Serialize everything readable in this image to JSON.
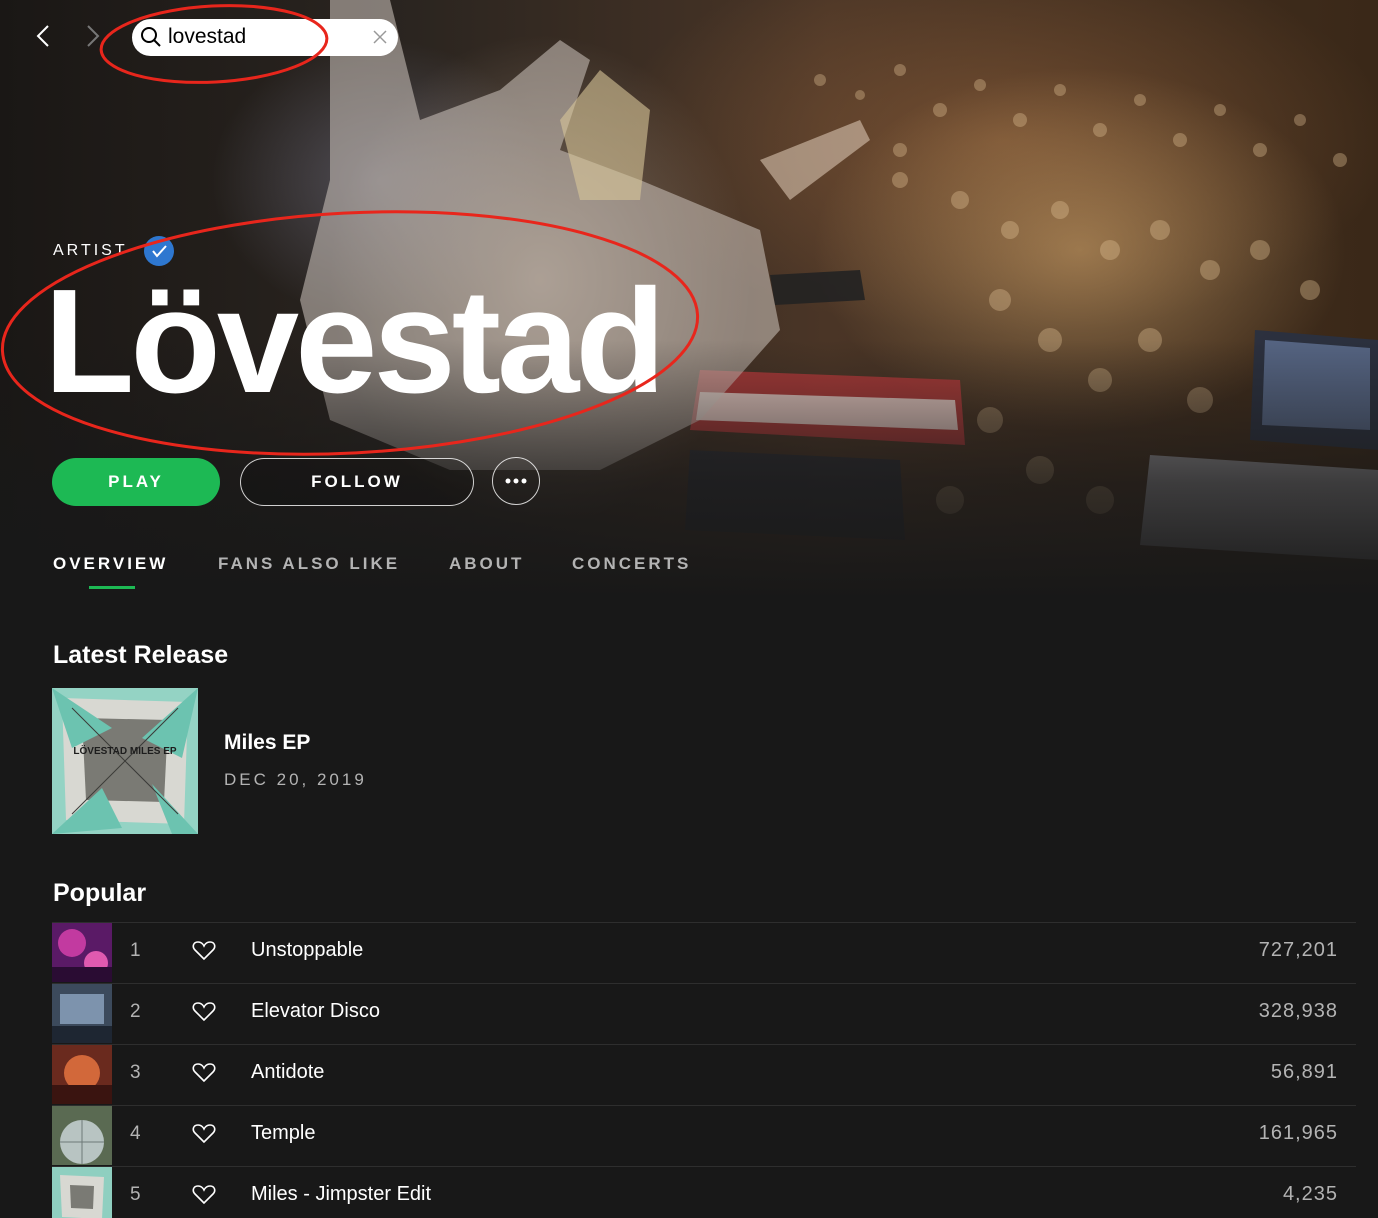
{
  "search": {
    "query": "lovestad"
  },
  "header": {
    "label": "ARTIST",
    "artist_name": "Lövestad"
  },
  "actions": {
    "play_label": "PLAY",
    "follow_label": "FOLLOW"
  },
  "tabs": [
    {
      "label": "OVERVIEW",
      "active": true
    },
    {
      "label": "FANS ALSO LIKE",
      "active": false
    },
    {
      "label": "ABOUT",
      "active": false
    },
    {
      "label": "CONCERTS",
      "active": false
    }
  ],
  "latest_release": {
    "section_title": "Latest Release",
    "cover_text": "LÖVESTAD MILES EP",
    "title": "Miles EP",
    "date": "DEC 20, 2019"
  },
  "popular": {
    "section_title": "Popular",
    "tracks": [
      {
        "num": "1",
        "title": "Unstoppable",
        "plays": "727,201"
      },
      {
        "num": "2",
        "title": "Elevator Disco",
        "plays": "328,938"
      },
      {
        "num": "3",
        "title": "Antidote",
        "plays": "56,891"
      },
      {
        "num": "4",
        "title": "Temple",
        "plays": "161,965"
      },
      {
        "num": "5",
        "title": "Miles - Jimpster Edit",
        "plays": "4,235"
      }
    ]
  },
  "icons": {
    "back": "chevron-left-icon",
    "forward": "chevron-right-icon",
    "search": "search-icon",
    "clear": "close-icon",
    "verified": "verified-check-icon",
    "more": "more-dots-icon",
    "heart": "heart-icon"
  },
  "colors": {
    "accent": "#1db954",
    "verified": "#2e77d0",
    "annotation": "#e8261c",
    "background": "#181818"
  }
}
